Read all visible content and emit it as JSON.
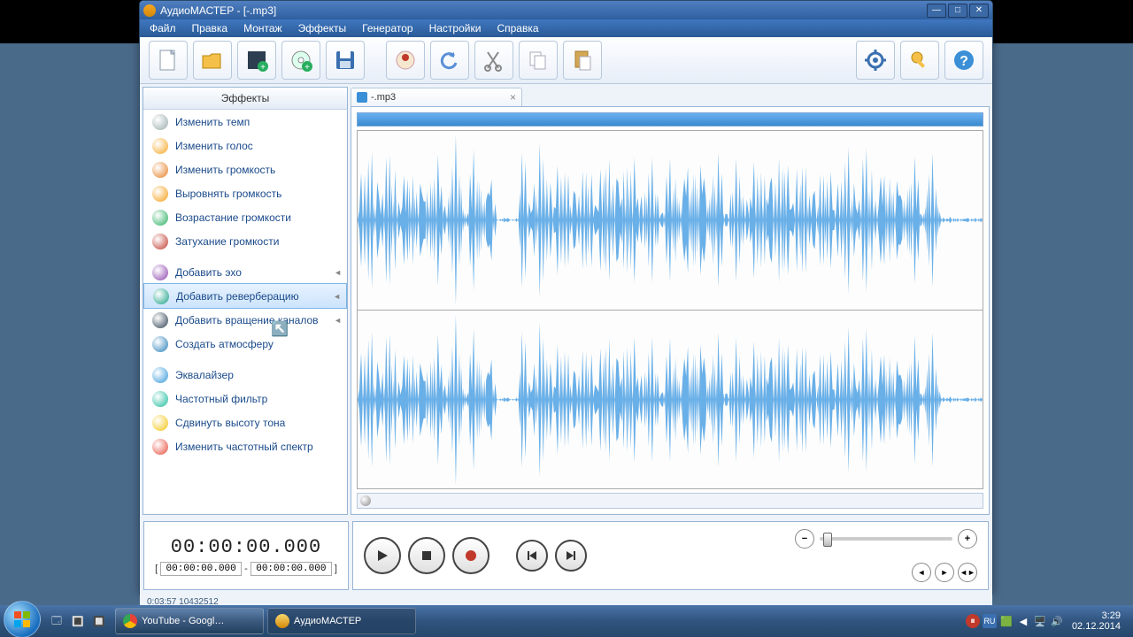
{
  "window": {
    "title": "АудиоМАСТЕР - [-.mp3]"
  },
  "menubar": [
    "Файл",
    "Правка",
    "Монтаж",
    "Эффекты",
    "Генератор",
    "Настройки",
    "Справка"
  ],
  "sidebar": {
    "header": "Эффекты",
    "groups": [
      [
        {
          "label": "Изменить темп",
          "icon": "#9aa"
        },
        {
          "label": "Изменить голос",
          "icon": "#f5a623"
        },
        {
          "label": "Изменить громкость",
          "icon": "#e67e22"
        },
        {
          "label": "Выровнять громкость",
          "icon": "#f39c12"
        },
        {
          "label": "Возрастание громкости",
          "icon": "#27ae60"
        },
        {
          "label": "Затухание громкости",
          "icon": "#c0392b"
        }
      ],
      [
        {
          "label": "Добавить эхо",
          "icon": "#8e44ad",
          "arrow": true
        },
        {
          "label": "Добавить реверберацию",
          "icon": "#16a085",
          "arrow": true,
          "selected": true
        },
        {
          "label": "Добавить вращение каналов",
          "icon": "#2c3e50",
          "arrow": true
        },
        {
          "label": "Создать атмосферу",
          "icon": "#2980b9"
        }
      ],
      [
        {
          "label": "Эквалайзер",
          "icon": "#3498db"
        },
        {
          "label": "Частотный фильтр",
          "icon": "#1abc9c"
        },
        {
          "label": "Сдвинуть высоту тона",
          "icon": "#f1c40f"
        },
        {
          "label": "Изменить частотный спектр",
          "icon": "#e74c3c"
        }
      ]
    ]
  },
  "tab": {
    "label": "-.mp3"
  },
  "time": {
    "main": "00:00:00.000",
    "sel_start": "00:00:00.000",
    "sel_end": "00:00:00.000"
  },
  "status": "0:03:57 10432512",
  "taskbar": {
    "items": [
      {
        "label": "YouTube - Googl…"
      },
      {
        "label": "АудиоМАСТЕР",
        "active": true
      }
    ],
    "clock": {
      "time": "3:29",
      "date": "02.12.2014"
    }
  }
}
